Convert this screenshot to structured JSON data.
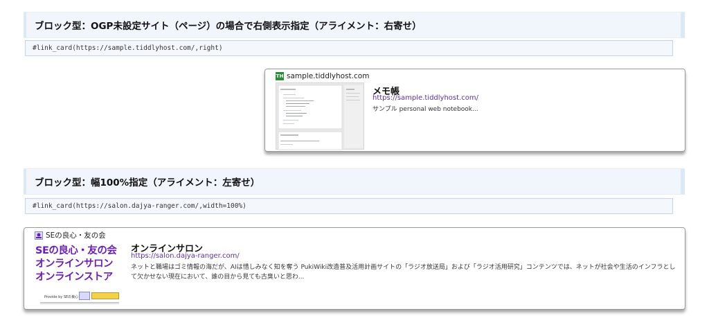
{
  "sections": [
    {
      "heading": "ブロック型：OGP未設定サイト（ページ）の場合で右側表示指定（アライメント：右寄せ）",
      "code": "#link_card(https://sample.tiddlyhost.com/,right)",
      "card": {
        "site_name": "sample.tiddlyhost.com",
        "favicon_text": "TH",
        "favicon_color": "#2e8b3a",
        "title": "メモ帳",
        "url": "https://sample.tiddlyhost.com/",
        "description": "サンプル personal web notebook..."
      }
    },
    {
      "heading": "ブロック型：幅100%指定（アライメント：左寄せ）",
      "code": "#link_card(https://salon.dajya-ranger.com/,width=100%)",
      "card": {
        "site_name": "SEの良心・友の会",
        "title": "オンラインサロン",
        "url": "https://salon.dajya-ranger.com/",
        "description": "ネットと職場はゴミ情報の海だが、AIは惜しみなく知を奪う PukiWiki改造普及活用計画サイトの「ラジオ放送局」および「ラジオ活用研究」コンテンツでは、ネットが社会や生活のインフラとして欠かせない現在において、誰の目から見ても古臭いと思わ...",
        "thumb_lines": [
          "SEの良心・友の会",
          "オンラインサロン",
          "オンラインストア"
        ],
        "thumb_caption": "Provide by SEの良心"
      }
    }
  ],
  "colors": {
    "accent_purple": "#6a1fb8",
    "link": "#5a2fb0"
  }
}
